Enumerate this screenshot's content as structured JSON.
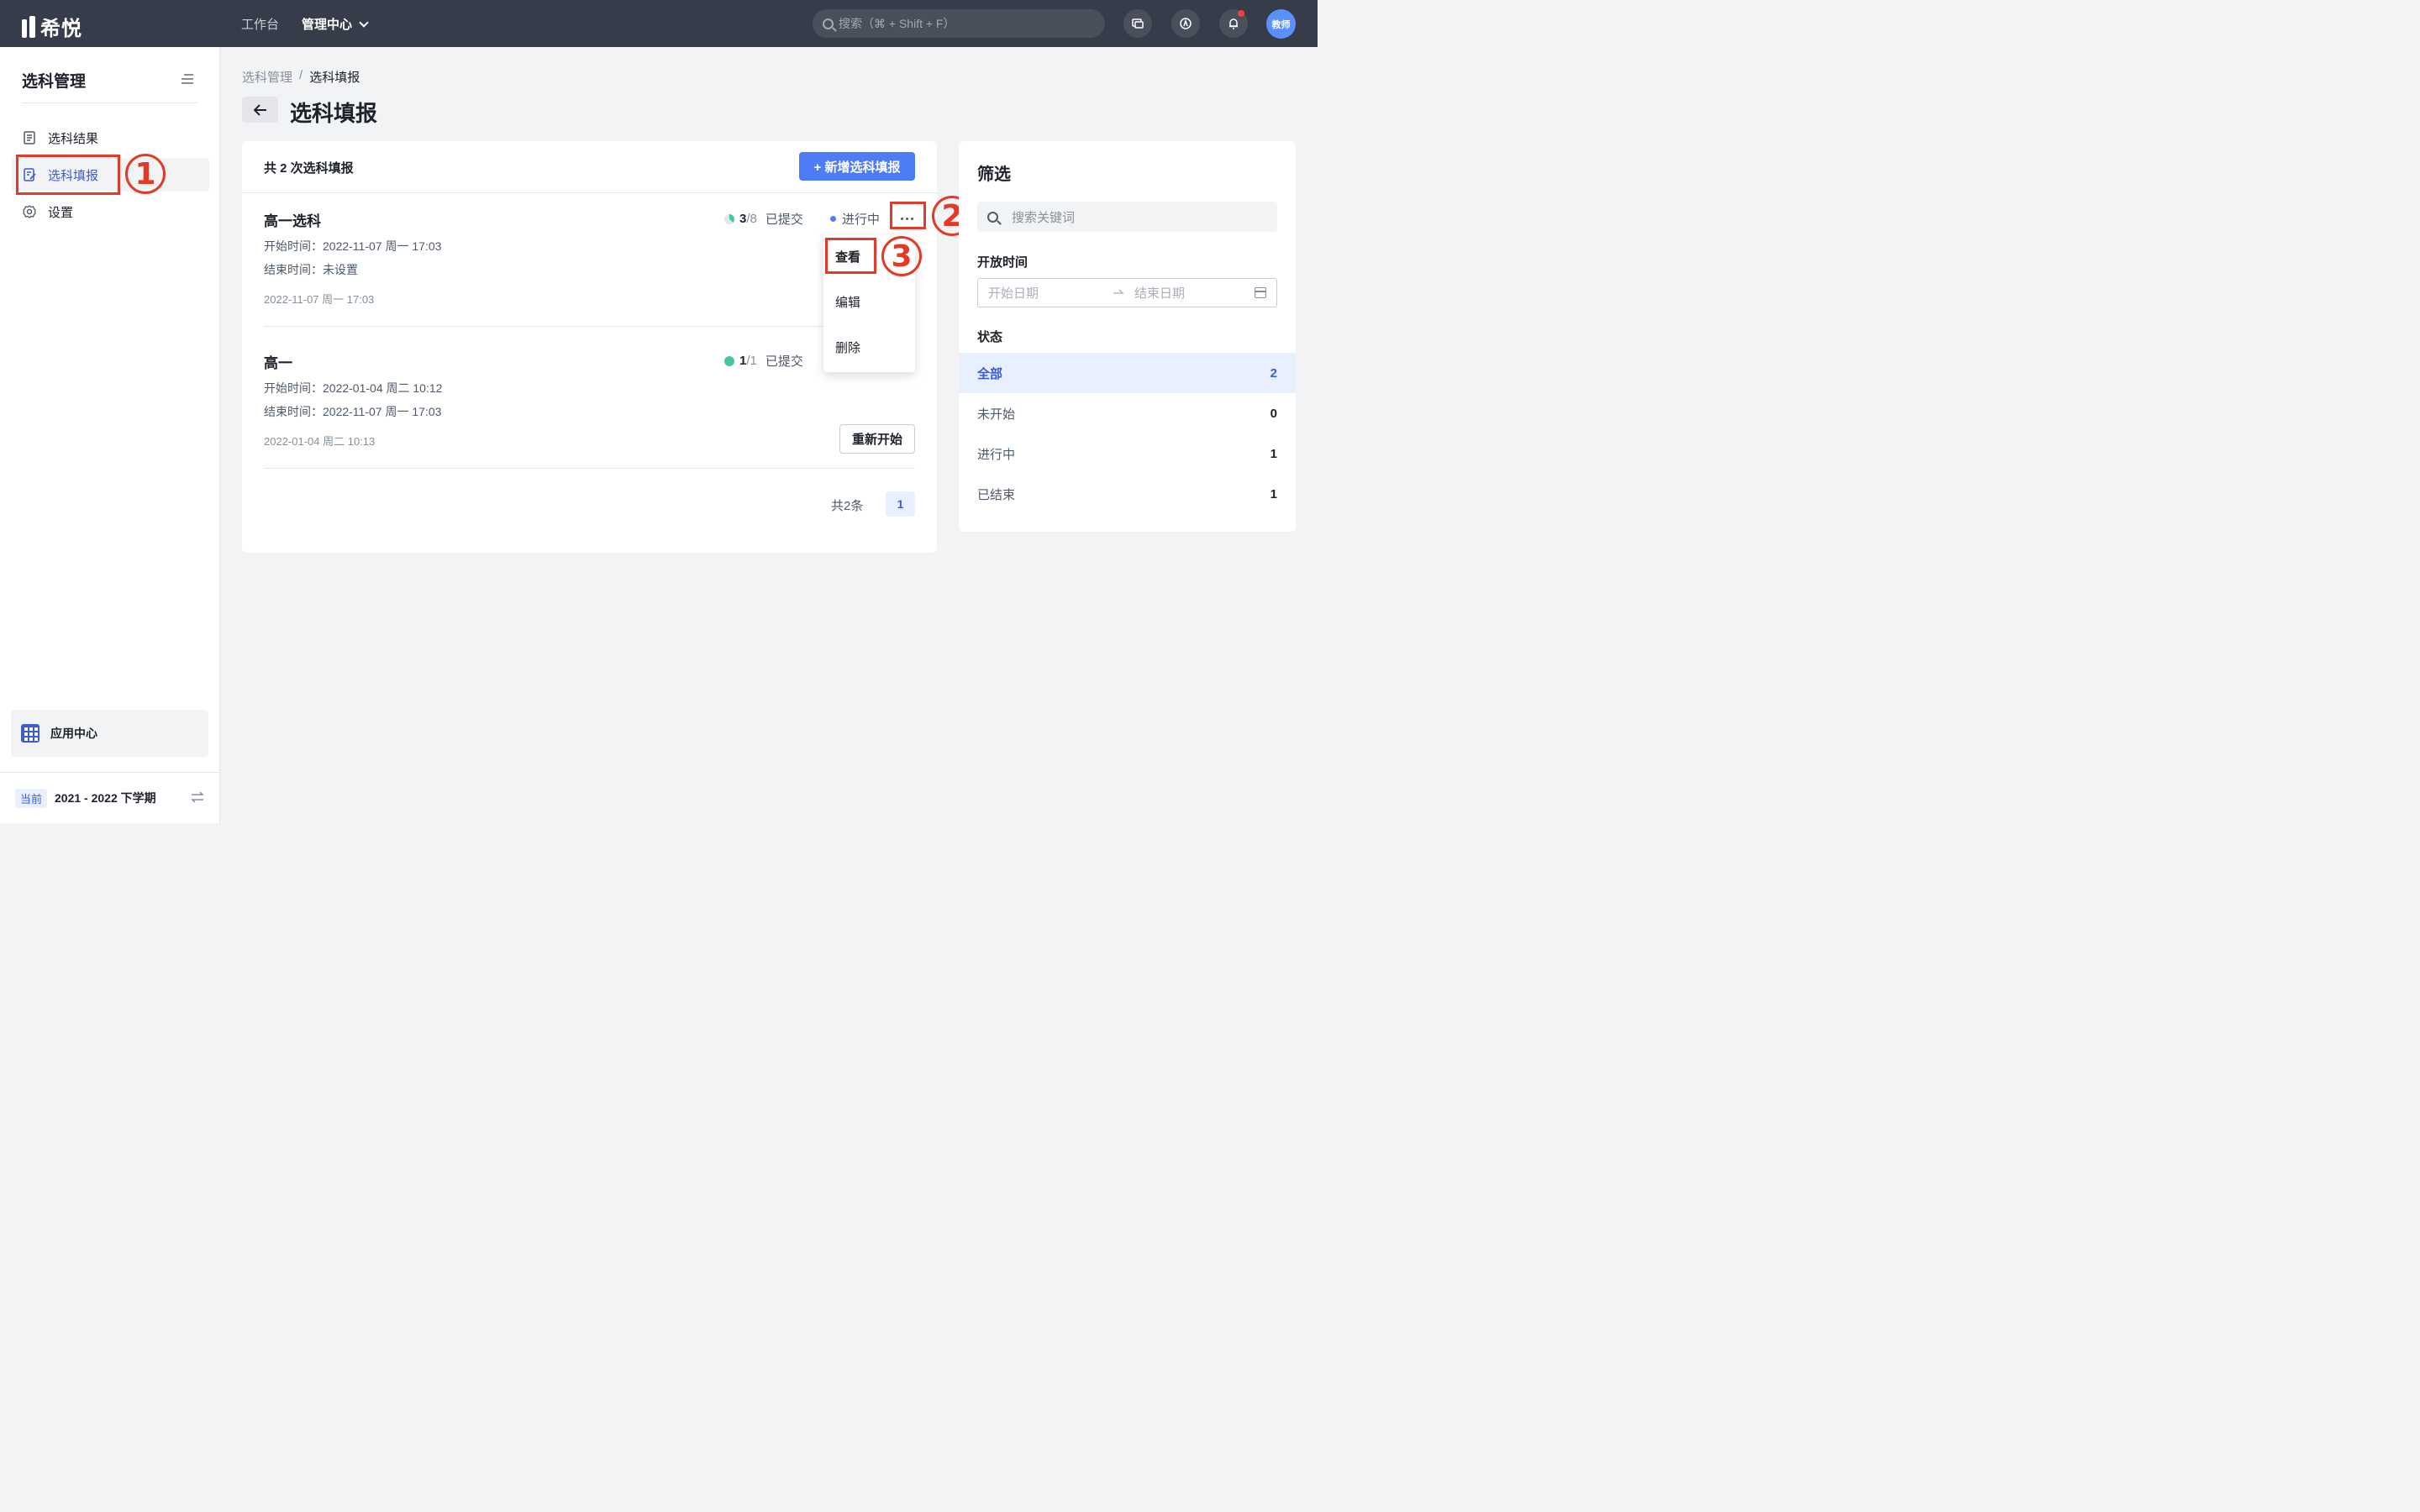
{
  "app": {
    "logo_text": "希悦"
  },
  "topnav": {
    "workbench": "工作台",
    "management": "管理中心",
    "search_placeholder": "搜索（⌘ + Shift + F）",
    "avatar_text": "教师"
  },
  "sidebar": {
    "title": "选科管理",
    "items": [
      {
        "label": "选科结果",
        "icon": "document-icon"
      },
      {
        "label": "选科填报",
        "icon": "edit-form-icon",
        "active": true
      },
      {
        "label": "设置",
        "icon": "gear-icon"
      }
    ],
    "app_center": "应用中心",
    "term_badge": "当前",
    "term_text": "2021 - 2022 下学期"
  },
  "breadcrumb": {
    "parent": "选科管理",
    "separator": "/",
    "current": "选科填报"
  },
  "page": {
    "title": "选科填报"
  },
  "list": {
    "summary": "共 2 次选科填报",
    "add_button": "+ 新增选科填报",
    "records": [
      {
        "title": "高一选科",
        "start": "开始时间：2022-11-07 周一 17:03",
        "end": "结束时间：未设置",
        "created": "2022-11-07 周一 17:03",
        "submitted": "3",
        "total": "/8",
        "submitted_label": "已提交",
        "progress": 0.375,
        "status": "进行中"
      },
      {
        "title": "高一",
        "start": "开始时间：2022-01-04 周二 10:12",
        "end": "结束时间：2022-11-07 周一 17:03",
        "created": "2022-01-04 周二 10:13",
        "submitted": "1",
        "total": "/1",
        "submitted_label": "已提交",
        "progress": 1.0,
        "action": "重新开始"
      }
    ],
    "pager_total": "共2条",
    "pager_current": "1"
  },
  "menu": {
    "view": "查看",
    "edit": "编辑",
    "delete": "删除"
  },
  "annotations": {
    "one": "1",
    "two": "2",
    "three": "3"
  },
  "filter": {
    "title": "筛选",
    "search_placeholder": "搜索关键词",
    "open_time_label": "开放时间",
    "start_placeholder": "开始日期",
    "end_placeholder": "结束日期",
    "status_label": "状态",
    "statuses": [
      {
        "label": "全部",
        "count": "2"
      },
      {
        "label": "未开始",
        "count": "0"
      },
      {
        "label": "进行中",
        "count": "1"
      },
      {
        "label": "已结束",
        "count": "1"
      }
    ]
  },
  "colors": {
    "accent": "#4e7cf6",
    "annotation": "#e23a26",
    "topbar": "#373c4a",
    "done_green": "#4cc3a0"
  }
}
